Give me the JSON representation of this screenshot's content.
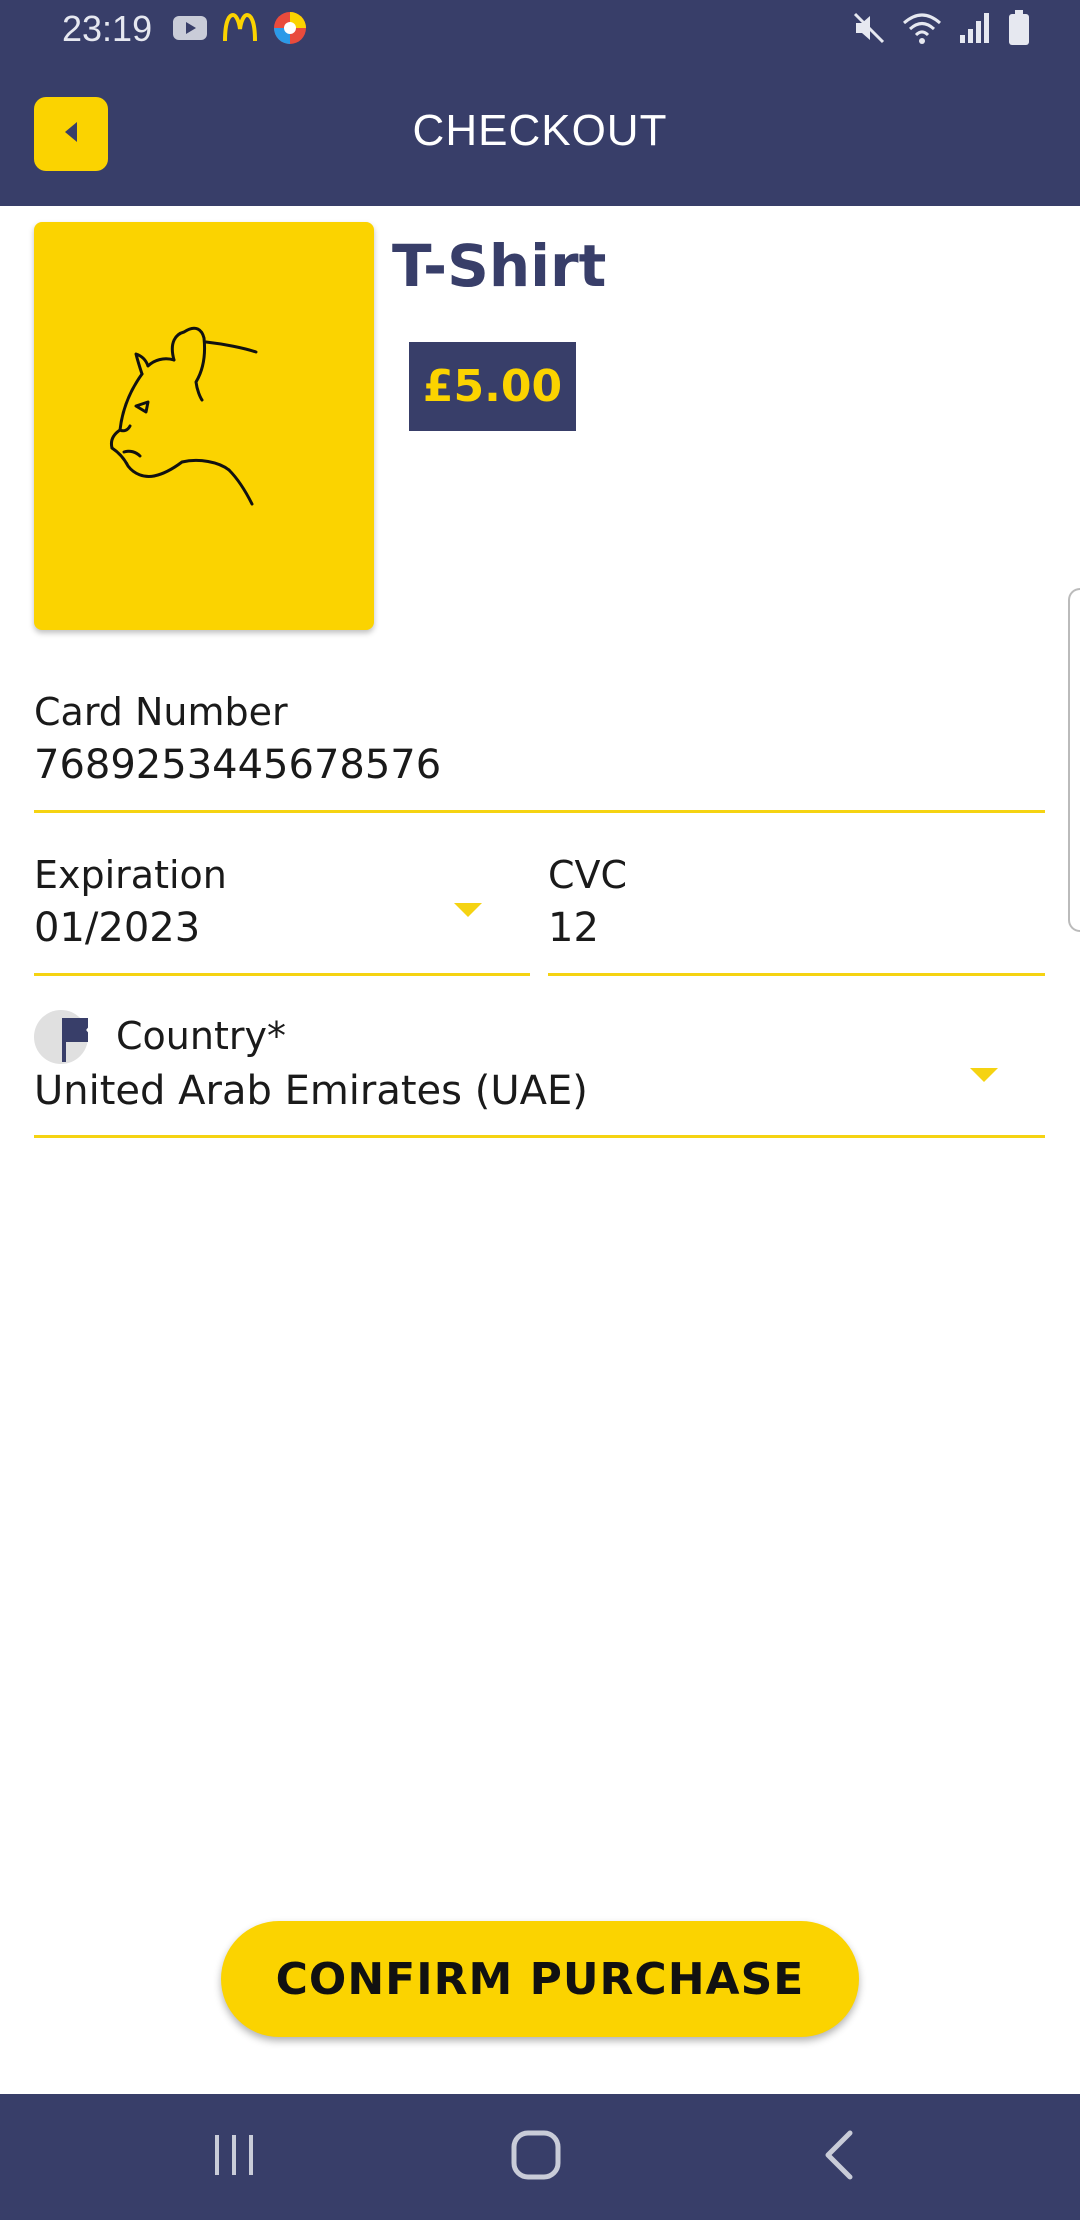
{
  "status_bar": {
    "time": "23:19",
    "left_icons": [
      "youtube-icon",
      "mcdonalds-icon",
      "chrome-like-icon"
    ],
    "right_icons": [
      "mute-icon",
      "wifi-icon",
      "signal-icon",
      "battery-icon"
    ]
  },
  "app_bar": {
    "title": "CHECKOUT",
    "back_icon": "caret-left-icon"
  },
  "product": {
    "name": "T-Shirt",
    "price": "£5.00",
    "image_icon": "panther-icon"
  },
  "form": {
    "card_number": {
      "label": "Card Number",
      "value": "7689253445678576"
    },
    "expiration": {
      "label": "Expiration",
      "value": "01/2023"
    },
    "cvc": {
      "label": "CVC",
      "value": "12"
    },
    "country": {
      "label": "Country*",
      "value": "United Arab Emirates (UAE)"
    }
  },
  "actions": {
    "confirm_label": "CONFIRM PURCHASE"
  },
  "colors": {
    "primary": "#383e69",
    "accent": "#fbd300"
  },
  "nav_bar": {
    "buttons": [
      "recent-apps-icon",
      "home-icon",
      "back-icon"
    ]
  }
}
